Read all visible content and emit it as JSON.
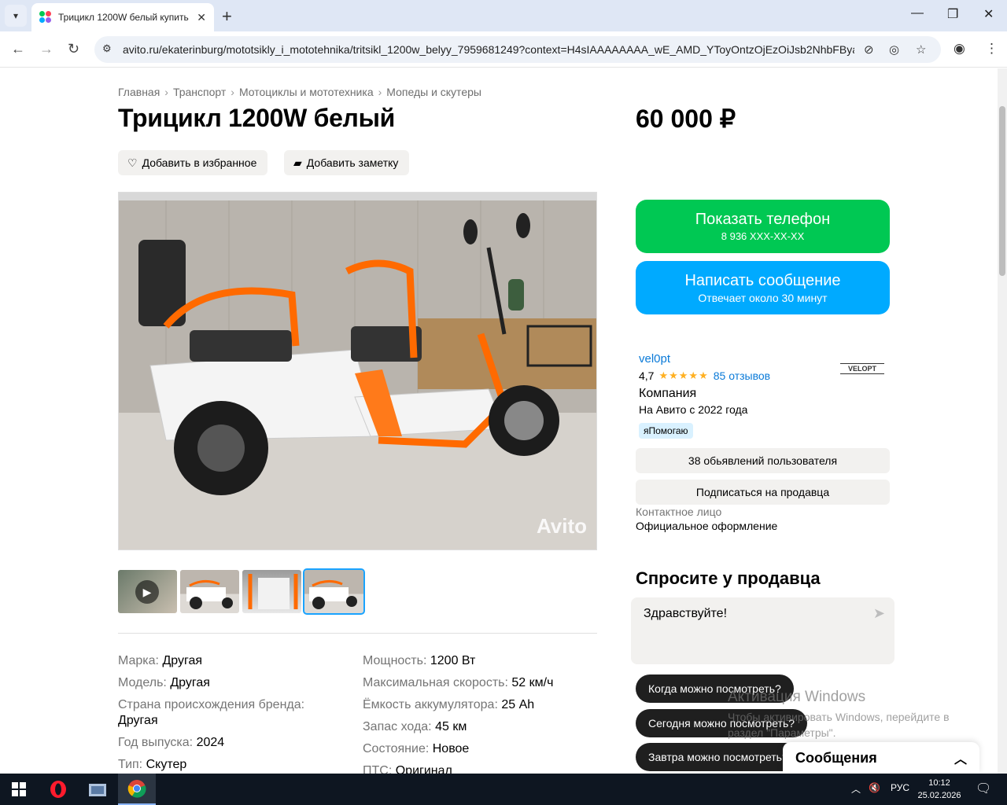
{
  "browser": {
    "tab_title": "Трицикл 1200W белый купить",
    "url": "avito.ru/ekaterinburg/mototsikly_i_mototehnika/tritsikl_1200w_belyy_7959681249?context=H4sIAAAAAAAA_wE_AMD_YToyOntzOjEzOiJsb2NhbFBya..."
  },
  "breadcrumbs": [
    "Главная",
    "Транспорт",
    "Мотоциклы и мототехника",
    "Мопеды и скутеры"
  ],
  "listing": {
    "title": "Трицикл 1200W белый",
    "price": "60 000 ₽",
    "favorite_label": "Добавить в избранное",
    "note_label": "Добавить заметку",
    "watermark": "Avito"
  },
  "params_left": [
    {
      "key": "Марка:",
      "value": "Другая"
    },
    {
      "key": "Модель:",
      "value": "Другая"
    },
    {
      "key": "Страна происхождения бренда:",
      "value": "Другая"
    },
    {
      "key": "Год выпуска:",
      "value": "2024"
    },
    {
      "key": "Тип:",
      "value": "Скутер"
    }
  ],
  "params_right": [
    {
      "key": "Мощность:",
      "value": "1200 Вт"
    },
    {
      "key": "Максимальная скорость:",
      "value": "52 км/ч"
    },
    {
      "key": "Ёмкость аккумулятора:",
      "value": "25 Ah"
    },
    {
      "key": "Запас хода:",
      "value": "45 км"
    },
    {
      "key": "Состояние:",
      "value": "Новое"
    },
    {
      "key": "ПТС:",
      "value": "Оригинал"
    }
  ],
  "actions": {
    "show_phone": "Показать телефон",
    "phone_masked": "8 936 XXX-XX-XX",
    "write_message": "Написать сообщение",
    "reply_time": "Отвечает около 30 минут"
  },
  "seller": {
    "name": "vel0pt",
    "rating": "4,7",
    "stars": "★★★★★",
    "reviews": "85 отзывов",
    "type": "Компания",
    "since": "На Авито с 2022 года",
    "badge": "яПомогаю",
    "logo_text": "VELOPT",
    "ads_count": "38 обьявлений пользователя",
    "subscribe": "Подписаться на продавца",
    "contact_label": "Контактное лицо",
    "contact_value": "Официальное оформление"
  },
  "ask": {
    "title": "Спросите у продавца",
    "message": "Здравствуйте!",
    "chips": [
      "Когда можно посмотреть?",
      "Сегодня можно посмотреть?",
      "Завтра можно посмотреть?"
    ]
  },
  "messages_panel": "Сообщения",
  "windows_activation": {
    "line1": "Активация Windows",
    "line2": "Чтобы активировать Windows, перейдите в",
    "line3": "раздел \"Параметры\"."
  },
  "taskbar": {
    "lang": "РУС",
    "time": "10:12",
    "date": "25.02.2026"
  },
  "colors": {
    "green_button": "#00c853",
    "blue_button": "#00aaff",
    "link": "#0a7ad8",
    "stars": "#ffb021"
  }
}
